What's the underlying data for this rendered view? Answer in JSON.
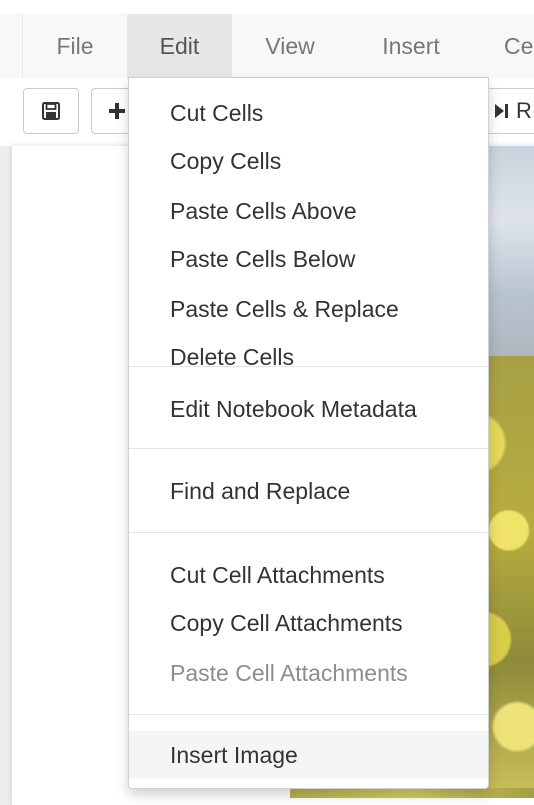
{
  "menubar": {
    "items": [
      {
        "label": "File",
        "active": false
      },
      {
        "label": "Edit",
        "active": true
      },
      {
        "label": "View",
        "active": false
      },
      {
        "label": "Insert",
        "active": false
      },
      {
        "label": "Ce",
        "active": false
      }
    ]
  },
  "toolbar": {
    "save_icon": "save-icon",
    "add_icon": "plus-icon",
    "run_icon": "run-icon",
    "run_label_partial": "R"
  },
  "edit_menu": {
    "items": [
      {
        "label": "Cut Cells",
        "enabled": true
      },
      {
        "label": "Copy Cells",
        "enabled": true
      },
      {
        "label": "Paste Cells Above",
        "enabled": true
      },
      {
        "label": "Paste Cells Below",
        "enabled": true
      },
      {
        "label": "Paste Cells & Replace",
        "enabled": true
      },
      {
        "label": "Delete Cells",
        "enabled": true
      },
      {
        "label": "Edit Notebook Metadata",
        "enabled": true
      },
      {
        "label": "Find and Replace",
        "enabled": true
      },
      {
        "label": "Cut Cell Attachments",
        "enabled": true
      },
      {
        "label": "Copy Cell Attachments",
        "enabled": true
      },
      {
        "label": "Paste Cell Attachments",
        "enabled": false
      },
      {
        "label": "Insert Image",
        "enabled": true,
        "hovered": true
      }
    ]
  },
  "colors": {
    "menubar_bg": "#f8f8f8",
    "active_menu_bg": "#e7e7e7",
    "menu_text": "#777777",
    "item_text": "#333333",
    "disabled_text": "#8d8d8d"
  }
}
